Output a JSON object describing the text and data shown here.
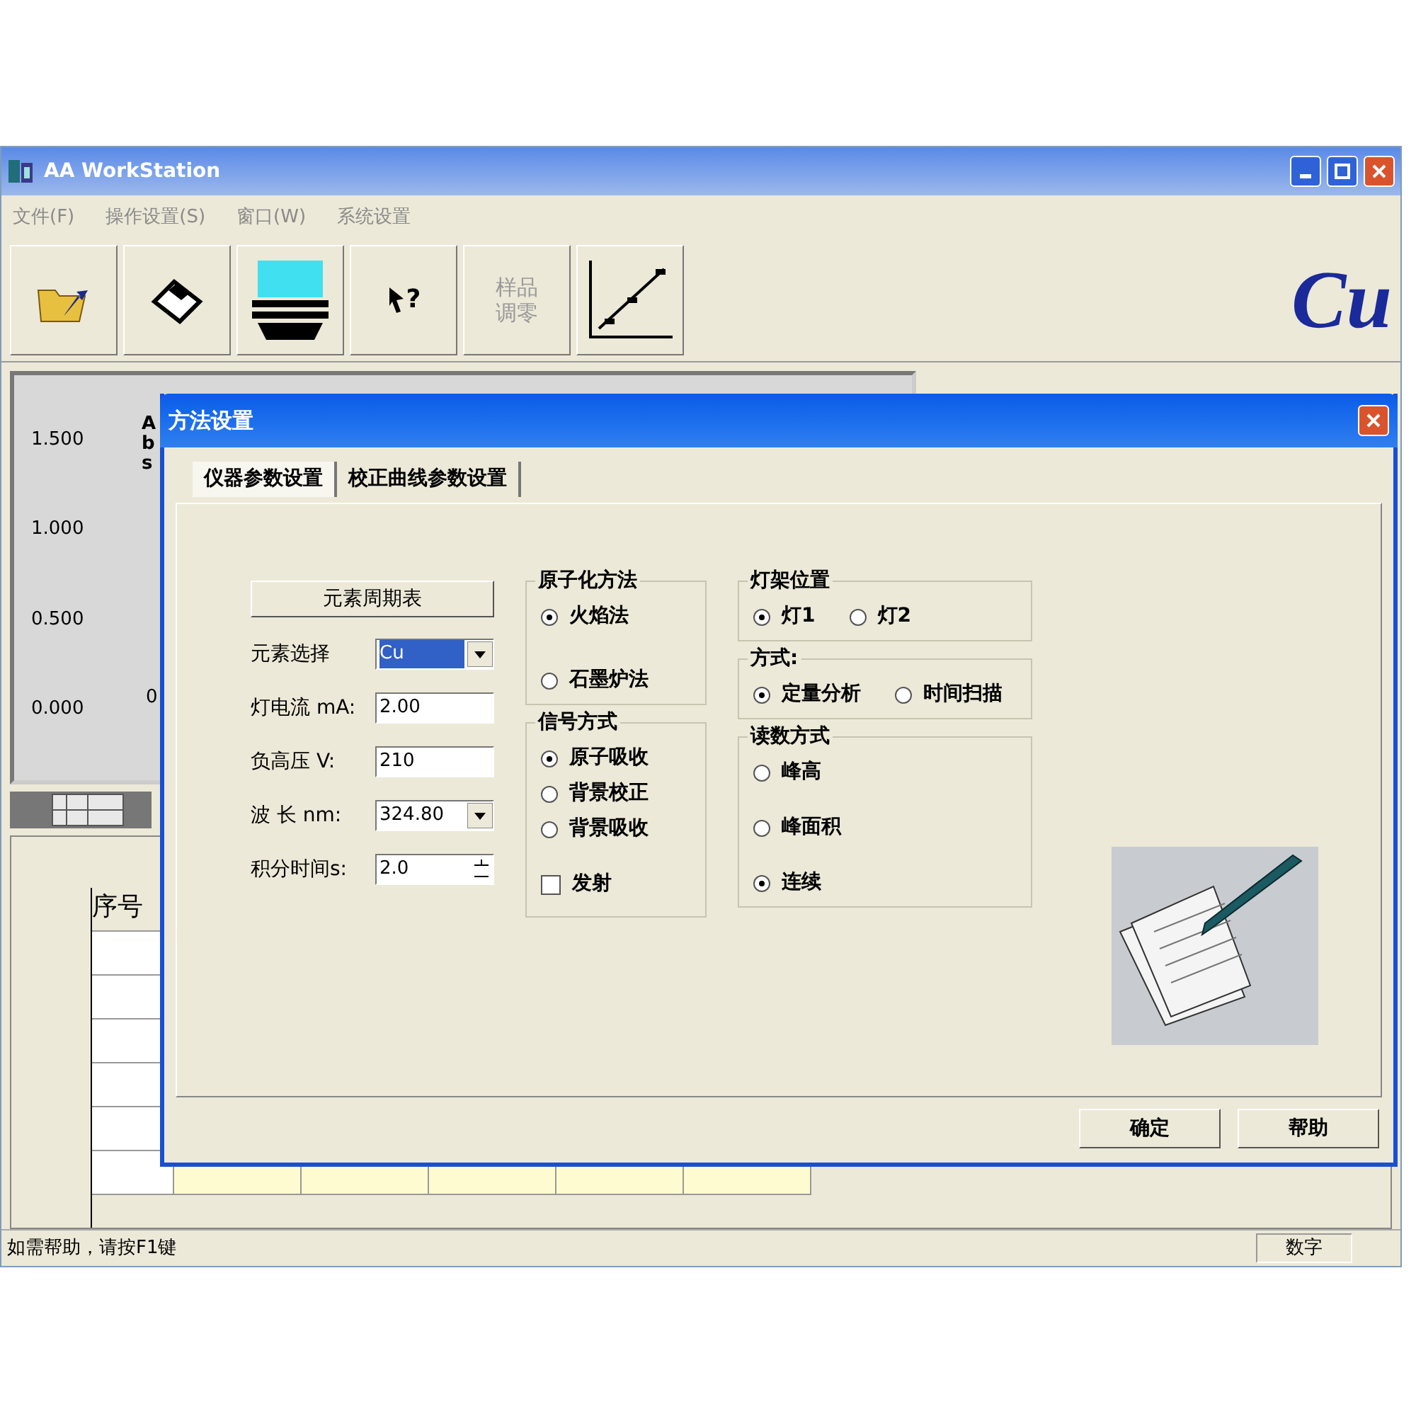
{
  "window": {
    "title": "AA WorkStation"
  },
  "menu": [
    "文件(F)",
    "操作设置(S)",
    "窗口(W)",
    "系统设置"
  ],
  "toolbar": [
    {
      "kind": "open",
      "disabled": false
    },
    {
      "kind": "save",
      "disabled": false
    },
    {
      "kind": "lamp",
      "disabled": false
    },
    {
      "kind": "help",
      "label": "?",
      "disabled": false
    },
    {
      "kind": "text",
      "label": [
        "样品",
        "调零"
      ],
      "disabled": true
    },
    {
      "kind": "curve",
      "disabled": false
    }
  ],
  "brand": "Cu",
  "plot": {
    "ylabel": "Abs",
    "yticks": [
      "1.500",
      "1.000",
      "0.500",
      "0.000"
    ],
    "xtick": "0"
  },
  "table": {
    "columns": [
      "序号"
    ]
  },
  "dialog": {
    "title": "方法设置",
    "tabs": [
      {
        "label": "仪器参数设置",
        "selected": true
      },
      {
        "label": "校正曲线参数设置",
        "selected": false
      }
    ],
    "periodic_button": "元素周期表",
    "fields": [
      {
        "kind": "select",
        "label": "元素选择",
        "value": "Cu",
        "highlighted": true
      },
      {
        "kind": "text",
        "label": "灯电流 mA:",
        "value": "2.00",
        "highlighted": false
      },
      {
        "kind": "text",
        "label": "负高压 V:",
        "value": "210",
        "highlighted": false
      },
      {
        "kind": "select",
        "label": "波 长 nm:",
        "value": "324.80",
        "highlighted": false
      },
      {
        "kind": "spin",
        "label": "积分时间s:",
        "value": "2.0",
        "highlighted": false
      }
    ],
    "group_columns": [
      [
        {
          "title": "原子化方法",
          "options": [
            {
              "kind": "radio",
              "label": "火焰法",
              "selected": true
            },
            {
              "kind": "radio",
              "label": "石墨炉法",
              "selected": false
            }
          ]
        },
        {
          "title": "信号方式",
          "options": [
            {
              "kind": "radio",
              "label": "原子吸收",
              "selected": true
            },
            {
              "kind": "radio",
              "label": "背景校正",
              "selected": false
            },
            {
              "kind": "radio",
              "label": "背景吸收",
              "selected": false
            },
            {
              "kind": "checkbox",
              "label": "发射",
              "checked": false
            }
          ]
        }
      ],
      [
        {
          "title": "灯架位置",
          "options": [
            {
              "kind": "radio",
              "label": "灯1",
              "selected": true
            },
            {
              "kind": "radio",
              "label": "灯2",
              "selected": false
            }
          ]
        },
        {
          "title": "方式:",
          "options": [
            {
              "kind": "radio",
              "label": "定量分析",
              "selected": true
            },
            {
              "kind": "radio",
              "label": "时间扫描",
              "selected": false
            }
          ]
        },
        {
          "title": "读数方式",
          "options": [
            {
              "kind": "radio",
              "label": "峰高",
              "selected": false
            },
            {
              "kind": "radio",
              "label": "峰面积",
              "selected": false
            },
            {
              "kind": "radio",
              "label": "连续",
              "selected": true
            }
          ]
        }
      ]
    ],
    "buttons": [
      "确定",
      "帮助"
    ]
  },
  "status_bar": [
    "如需帮助，请按F1键",
    "数字"
  ]
}
